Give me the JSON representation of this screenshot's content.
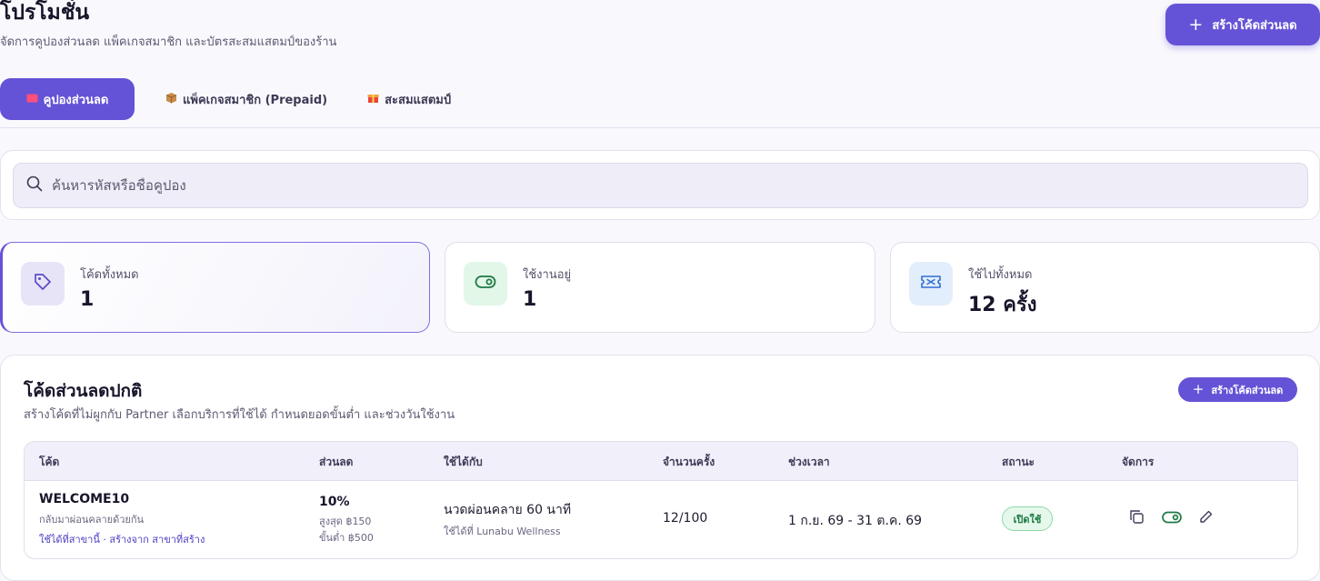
{
  "header": {
    "title": "โปรโมชั่น",
    "subtitle": "จัดการคูปองส่วนลด แพ็คเกจสมาชิก และบัตรสะสมแสตมป์ของร้าน",
    "create_button": "สร้างโค้ดส่วนลด"
  },
  "tabs": [
    {
      "label": "คูปองส่วนลด",
      "icon": "ticket-icon",
      "active": true
    },
    {
      "label": "แพ็คเกจสมาชิก (Prepaid)",
      "icon": "package-icon",
      "active": false
    },
    {
      "label": "สะสมแสตมป์",
      "icon": "gift-icon",
      "active": false
    }
  ],
  "search": {
    "placeholder": "ค้นหารหัสหรือชื่อคูปอง",
    "value": ""
  },
  "stats": [
    {
      "label": "โค้ดทั้งหมด",
      "value": "1",
      "icon": "tag-icon"
    },
    {
      "label": "ใช้งานอยู่",
      "value": "1",
      "icon": "toggle-icon"
    },
    {
      "label": "ใช้ไปทั้งหมด",
      "value": "12 ครั้ง",
      "icon": "ticket-icon"
    }
  ],
  "section": {
    "title": "โค้ดส่วนลดปกติ",
    "subtitle": "สร้างโค้ดที่ไม่ผูกกับ Partner เลือกบริการที่ใช้ได้ กำหนดยอดขั้นต่ำ และช่วงวันใช้งาน",
    "create_button": "สร้างโค้ดส่วนลด"
  },
  "table": {
    "columns": [
      "โค้ด",
      "ส่วนลด",
      "ใช้ได้กับ",
      "จำนวนครั้ง",
      "ช่วงเวลา",
      "สถานะ",
      "จัดการ"
    ],
    "rows": [
      {
        "code": "WELCOME10",
        "description": "กลับมาผ่อนคลายด้วยกัน",
        "scope": "ใช้ได้ที่สาขานี้ · สร้างจาก สาขาที่สร้าง",
        "discount": "10%",
        "max": "สูงสุด ฿150",
        "min": "ขั้นต่ำ ฿500",
        "service": "นวดผ่อนคลาย 60 นาที",
        "location": "ใช้ได้ที่ Lunabu Wellness",
        "usage": "12/100",
        "period": "1 ก.ย. 69 - 31 ต.ค. 69",
        "status": "เปิดใช้"
      }
    ]
  },
  "colors": {
    "accent": "#6453d6",
    "status_active_bg": "#e6f8ec",
    "status_active_text": "#1d7a43"
  }
}
